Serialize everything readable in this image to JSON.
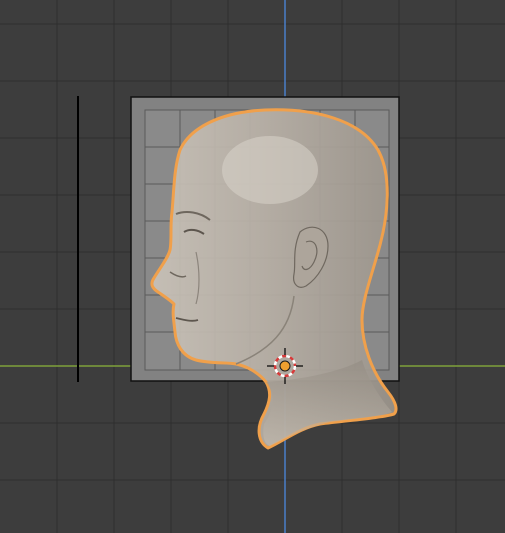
{
  "viewport": {
    "background_color": "#3d3d3d",
    "grid_color": "#2f2f2f",
    "x_axis_color": "#7fa23b",
    "z_axis_color": "#4a7fc9",
    "selection_outline_color": "#f0a04b",
    "origin_color": "#f0a030",
    "cursor_colors": [
      "#d83a3a",
      "#ffffff"
    ]
  },
  "reference_image": {
    "frame_color": "#111111",
    "grid_color": "#5a5a5a",
    "skin_color": "#b9b2a8"
  },
  "icons": {
    "cursor": "3d-cursor-icon",
    "origin": "object-origin-icon"
  }
}
